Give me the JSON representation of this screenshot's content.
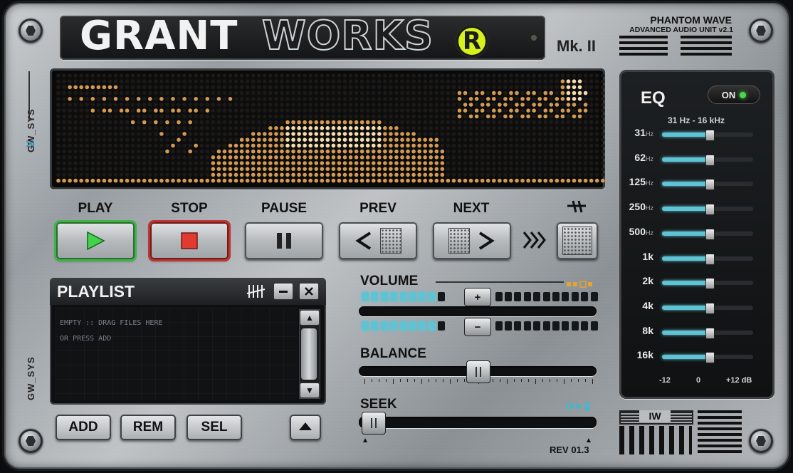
{
  "brand": {
    "logo_grant": "GRANT",
    "logo_works": "WORKS",
    "logo_mark": "R",
    "model": "Mk. II",
    "product": "PHANTOM WAVE",
    "subtitle": "ADVANCED AUDIO UNIT v2.1",
    "side_top": "GW_SYS",
    "side_bottom": "GW_SYS",
    "revision": "REV 01.3",
    "plate_logo": "IW"
  },
  "colors": {
    "display_dot": "#d59a52",
    "display_hot": "#f6dcae",
    "eq_fill": "#5fc3d4",
    "meter_on": "#5fc3d4",
    "play_glow": "#3fb34a",
    "stop_glow": "#c0332e",
    "led_on": "#47d847",
    "accent_yellow": "#d7f21a"
  },
  "transport": {
    "play": "PLAY",
    "stop": "STOP",
    "pause": "PAUSE",
    "prev": "PREV",
    "next": "NEXT"
  },
  "playlist": {
    "title": "PLAYLIST",
    "empty_line1": "EMPTY :: DRAG FILES HERE",
    "empty_line2": "OR PRESS ADD",
    "add": "ADD",
    "rem": "REM",
    "sel": "SEL"
  },
  "volume": {
    "label": "VOLUME",
    "plus": "+",
    "minus": "−",
    "upper_level": 0.33,
    "lower_level": 0.33
  },
  "balance": {
    "label": "BALANCE",
    "position": 0.5
  },
  "seek": {
    "label": "SEEK",
    "position": 0.0
  },
  "eq": {
    "title": "EQ",
    "power": "ON",
    "range": "31 Hz - 16 kHz",
    "scale": [
      "-12",
      "0",
      "+12 dB"
    ],
    "bands": [
      {
        "value": "31",
        "unit": "Hz",
        "level": 0.52
      },
      {
        "value": "62",
        "unit": "Hz",
        "level": 0.52
      },
      {
        "value": "125",
        "unit": "Hz",
        "level": 0.52
      },
      {
        "value": "250",
        "unit": "Hz",
        "level": 0.52
      },
      {
        "value": "500",
        "unit": "Hz",
        "level": 0.52
      },
      {
        "value": "1k",
        "unit": "",
        "level": 0.52
      },
      {
        "value": "2k",
        "unit": "",
        "level": 0.52
      },
      {
        "value": "4k",
        "unit": "",
        "level": 0.52
      },
      {
        "value": "8k",
        "unit": "",
        "level": 0.52
      },
      {
        "value": "16k",
        "unit": "",
        "level": 0.52
      }
    ]
  }
}
